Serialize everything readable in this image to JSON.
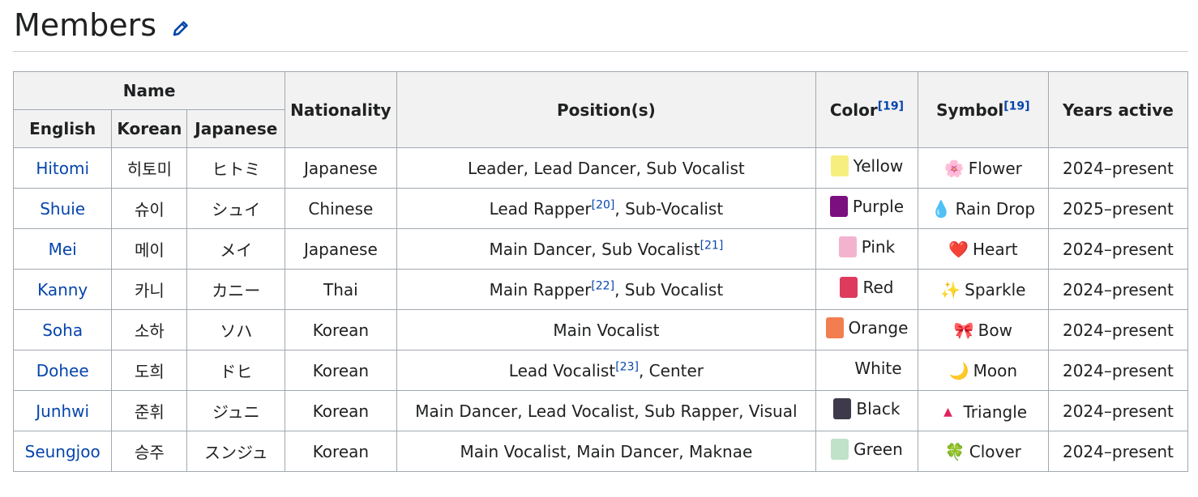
{
  "section": {
    "title": "Members"
  },
  "table": {
    "header": {
      "name": "Name",
      "english": "English",
      "korean": "Korean",
      "japanese": "Japanese",
      "nationality": "Nationality",
      "positions": "Position(s)",
      "color": "Color",
      "color_ref": "[19]",
      "symbol": "Symbol",
      "symbol_ref": "[19]",
      "years": "Years active"
    },
    "rows": [
      {
        "english": "Hitomi",
        "korean": "히토미",
        "japanese": "ヒトミ",
        "nationality": "Japanese",
        "pos_a": "Leader, Lead Dancer, Sub Vocalist",
        "pos_ref": "",
        "pos_b": "",
        "swatch": "#f6ef7f",
        "color": "Yellow",
        "symbol_glyph": "🌸",
        "symbol": "Flower",
        "years": "2024–present"
      },
      {
        "english": "Shuie",
        "korean": "슈이",
        "japanese": "シュイ",
        "nationality": "Chinese",
        "pos_a": "Lead Rapper",
        "pos_ref": "[20]",
        "pos_b": ", Sub-Vocalist",
        "swatch": "#7b0f7f",
        "color": "Purple",
        "symbol_glyph": "💧",
        "symbol": "Rain Drop",
        "years": "2025–present"
      },
      {
        "english": "Mei",
        "korean": "메이",
        "japanese": "メイ",
        "nationality": "Japanese",
        "pos_a": "Main Dancer, Sub Vocalist",
        "pos_ref": "[21]",
        "pos_b": "",
        "swatch": "#f3b3cf",
        "color": "Pink",
        "symbol_glyph": "❤️",
        "symbol": "Heart",
        "years": "2024–present"
      },
      {
        "english": "Kanny",
        "korean": "카니",
        "japanese": "カニー",
        "nationality": "Thai",
        "pos_a": "Main Rapper",
        "pos_ref": "[22]",
        "pos_b": ", Sub Vocalist",
        "swatch": "#de3a5e",
        "color": "Red",
        "symbol_glyph": "✨",
        "symbol": "Sparkle",
        "years": "2024–present"
      },
      {
        "english": "Soha",
        "korean": "소하",
        "japanese": "ソハ",
        "nationality": "Korean",
        "pos_a": "Main Vocalist",
        "pos_ref": "",
        "pos_b": "",
        "swatch": "#f27e4f",
        "color": "Orange",
        "symbol_glyph": "🎀",
        "symbol": "Bow",
        "years": "2024–present"
      },
      {
        "english": "Dohee",
        "korean": "도희",
        "japanese": "ドヒ",
        "nationality": "Korean",
        "pos_a": "Lead Vocalist",
        "pos_ref": "[23]",
        "pos_b": ", Center",
        "swatch": "#ffffff",
        "color": "White",
        "symbol_glyph": "🌙",
        "symbol": "Moon",
        "years": "2024–present"
      },
      {
        "english": "Junhwi",
        "korean": "준휘",
        "japanese": "ジュニ",
        "nationality": "Korean",
        "pos_a": "Main Dancer, Lead Vocalist, Sub Rapper, Visual",
        "pos_ref": "",
        "pos_b": "",
        "swatch": "#3e3a4c",
        "color": "Black",
        "symbol_glyph": "▲",
        "symbol": "Triangle",
        "years": "2024–present"
      },
      {
        "english": "Seungjoo",
        "korean": "승주",
        "japanese": "スンジュ",
        "nationality": "Korean",
        "pos_a": "Main Vocalist, Main Dancer, Maknae",
        "pos_ref": "",
        "pos_b": "",
        "swatch": "#bfe2c8",
        "color": "Green",
        "symbol_glyph": "🍀",
        "symbol": "Clover",
        "years": "2024–present"
      }
    ]
  },
  "colors": {
    "link": "#0645ad",
    "header_bg": "#f2f2f2",
    "border": "#a2a9b1"
  }
}
